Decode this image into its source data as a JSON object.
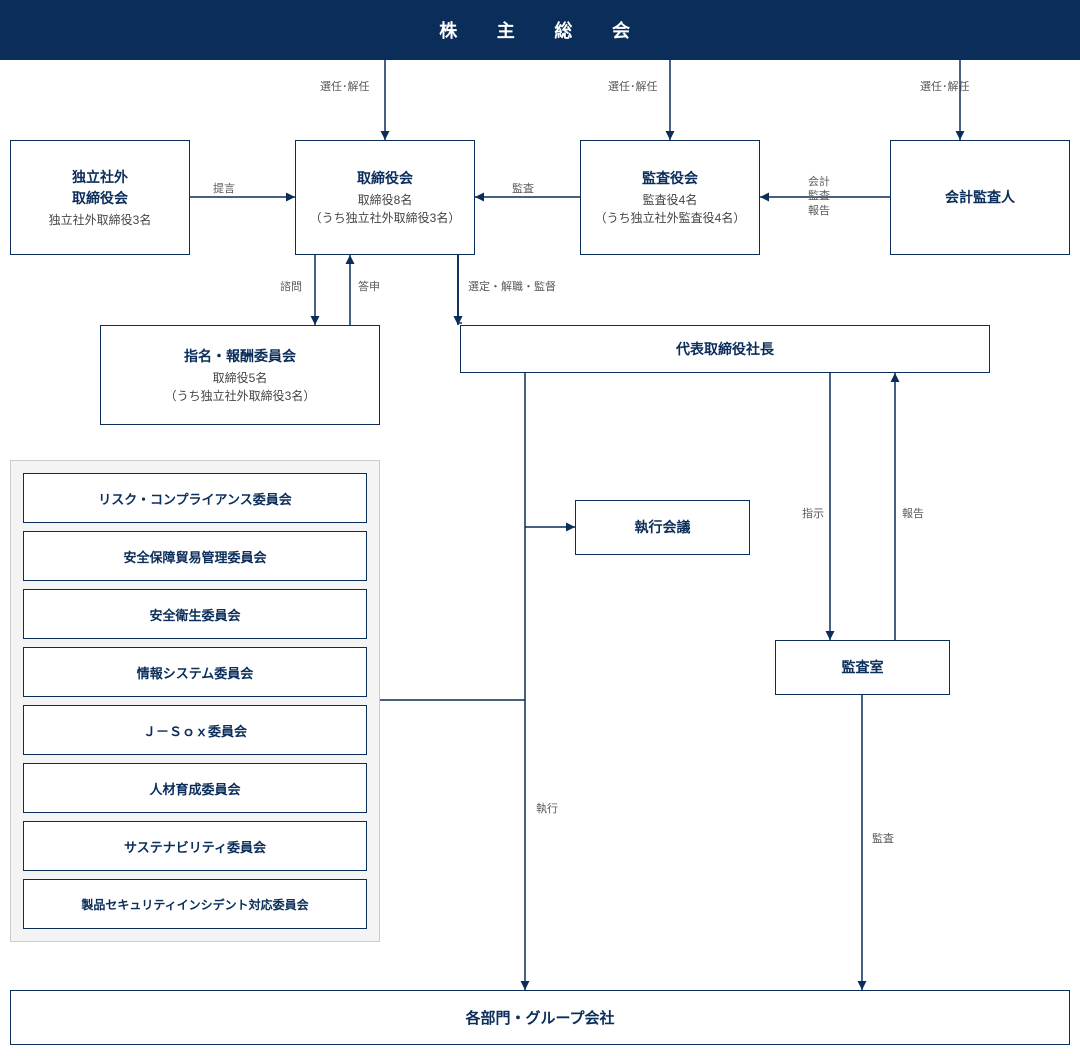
{
  "header": "株　主　総　会",
  "labels": {
    "appoint_dismiss": "選任･解任",
    "propose": "提言",
    "audit": "監査",
    "audit_report": "会計\n監査\n報告",
    "inquire": "諮問",
    "respond": "答申",
    "select_supervise": "選定・解職・監督",
    "instruct": "指示",
    "report": "報告",
    "execute": "執行",
    "audit2": "監査"
  },
  "boxes": {
    "outside_dir": {
      "title": "独立社外\n取締役会",
      "sub": "独立社外取締役3名"
    },
    "board": {
      "title": "取締役会",
      "sub": "取締役8名\n（うち独立社外取締役3名）"
    },
    "auditors": {
      "title": "監査役会",
      "sub": "監査役4名\n（うち独立社外監査役4名）"
    },
    "acct_auditor": {
      "title": "会計監査人"
    },
    "nom_comp": {
      "title": "指名・報酬委員会",
      "sub": "取締役5名\n（うち独立社外取締役3名）"
    },
    "president": {
      "title": "代表取締役社長"
    },
    "exec_mtg": {
      "title": "執行会議"
    },
    "audit_office": {
      "title": "監査室"
    },
    "bottom": {
      "title": "各部門・グループ会社"
    }
  },
  "committees": [
    "リスク・コンプライアンス委員会",
    "安全保障貿易管理委員会",
    "安全衛生委員会",
    "情報システム委員会",
    "Ｊ－Ｓｏｘ委員会",
    "人材育成委員会",
    "サステナビリティ委員会",
    "製品セキュリティインシデント対応委員会"
  ]
}
